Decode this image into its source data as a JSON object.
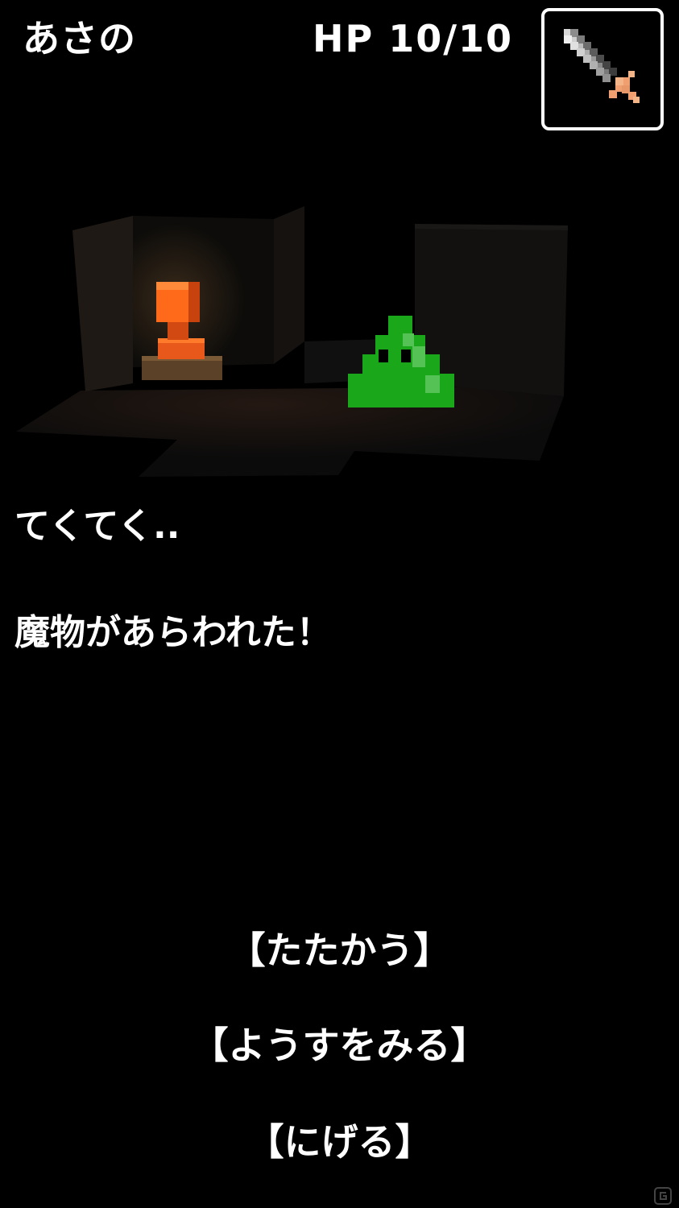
{
  "status": {
    "player_name": "あさの",
    "hp_text": "HP 10/10"
  },
  "equipment": {
    "weapon_icon": "sword-icon",
    "blade_color": "#9a9a9a",
    "hilt_color": "#f0a070"
  },
  "scene": {
    "torch_color": "#ff6a1a",
    "monster_icon": "green-slime",
    "monster_color": "#1aa81a"
  },
  "messages": {
    "walk": "てくてく..",
    "encounter": "魔物があらわれた！"
  },
  "commands": {
    "fight": "【たたかう】",
    "look": "【ようすをみる】",
    "flee": "【にげる】"
  }
}
